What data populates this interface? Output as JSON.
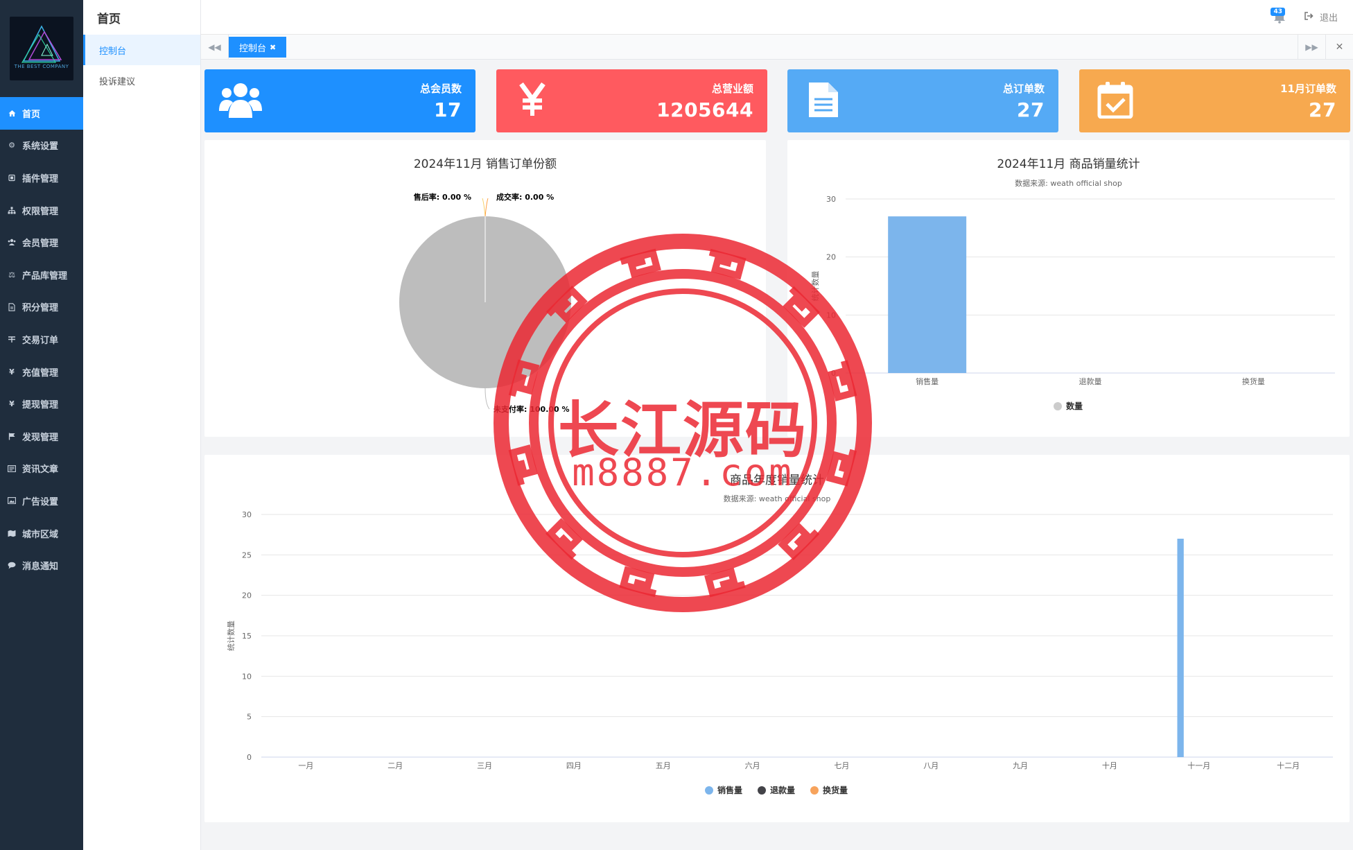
{
  "sidebar": {
    "logo_text": "THE BEST COMPANY",
    "items": [
      {
        "label": "首页",
        "icon": "home-icon",
        "active": true
      },
      {
        "label": "系统设置",
        "icon": "gear-icon"
      },
      {
        "label": "插件管理",
        "icon": "plugin-icon"
      },
      {
        "label": "权限管理",
        "icon": "sitemap-icon"
      },
      {
        "label": "会员管理",
        "icon": "users-icon"
      },
      {
        "label": "产品库管理",
        "icon": "scale-icon"
      },
      {
        "label": "积分管理",
        "icon": "file-icon"
      },
      {
        "label": "交易订单",
        "icon": "order-icon"
      },
      {
        "label": "充值管理",
        "icon": "yen-icon"
      },
      {
        "label": "提现管理",
        "icon": "yen-icon"
      },
      {
        "label": "发现管理",
        "icon": "flag-icon"
      },
      {
        "label": "资讯文章",
        "icon": "news-icon"
      },
      {
        "label": "广告设置",
        "icon": "image-icon"
      },
      {
        "label": "城市区域",
        "icon": "map-icon"
      },
      {
        "label": "消息通知",
        "icon": "chat-icon"
      }
    ]
  },
  "submenu": {
    "title": "首页",
    "items": [
      {
        "label": "控制台",
        "active": true
      },
      {
        "label": "投诉建议"
      }
    ]
  },
  "topbar": {
    "notification_count": "43",
    "logout_label": "退出"
  },
  "tabs": {
    "active_tab": "控制台"
  },
  "stats": [
    {
      "label": "总会员数",
      "value": "17",
      "icon": "users-icon",
      "color": "#1e90ff"
    },
    {
      "label": "总营业额",
      "value": "1205644",
      "icon": "yen-icon",
      "color": "#ff5a5f"
    },
    {
      "label": "总订单数",
      "value": "27",
      "icon": "document-icon",
      "color": "#55aaf5"
    },
    {
      "label": "11月订单数",
      "value": "27",
      "icon": "calendar-check-icon",
      "color": "#f7a94f"
    }
  ],
  "chart_data": [
    {
      "type": "pie",
      "title": "2024年11月 销售订单份额",
      "slices": [
        {
          "label": "售后率",
          "value": 0.0,
          "display": "售后率: 0.00 %"
        },
        {
          "label": "成交率",
          "value": 0.0,
          "display": "成交率: 0.00 %"
        },
        {
          "label": "未支付率",
          "value": 100.0,
          "display": "未支付率: 100.00 %"
        }
      ],
      "colors": [
        "#ff9f40",
        "#f7d06b",
        "#bdbdbd"
      ]
    },
    {
      "type": "bar",
      "title": "2024年11月 商品销量统计",
      "subtitle": "数据来源: weath official shop",
      "categories": [
        "销售量",
        "退款量",
        "换货量"
      ],
      "series": [
        {
          "name": "数量",
          "values": [
            27,
            0,
            0
          ],
          "color": "#7cb5ec"
        }
      ],
      "ylabel": "统计数量",
      "ylim": [
        0,
        30
      ],
      "yticks": [
        0,
        10,
        20,
        30
      ],
      "legend_color": "#cccccc"
    },
    {
      "type": "bar",
      "title": "商品年度销量统计",
      "subtitle": "数据来源: weath official shop",
      "categories": [
        "一月",
        "二月",
        "三月",
        "四月",
        "五月",
        "六月",
        "七月",
        "八月",
        "九月",
        "十月",
        "十一月",
        "十二月"
      ],
      "series": [
        {
          "name": "销售量",
          "values": [
            0,
            0,
            0,
            0,
            0,
            0,
            0,
            0,
            0,
            0,
            27,
            0
          ],
          "color": "#7cb5ec"
        },
        {
          "name": "退款量",
          "values": [
            0,
            0,
            0,
            0,
            0,
            0,
            0,
            0,
            0,
            0,
            0,
            0
          ],
          "color": "#434348"
        },
        {
          "name": "换货量",
          "values": [
            0,
            0,
            0,
            0,
            0,
            0,
            0,
            0,
            0,
            0,
            0,
            0
          ],
          "color": "#f7a35c"
        }
      ],
      "ylabel": "统计数量",
      "ylim": [
        0,
        30
      ],
      "yticks": [
        0,
        5,
        10,
        15,
        20,
        25,
        30
      ]
    }
  ],
  "watermark": {
    "main": "长江源码",
    "url": "m8887.com",
    "color": "#eb2832"
  }
}
